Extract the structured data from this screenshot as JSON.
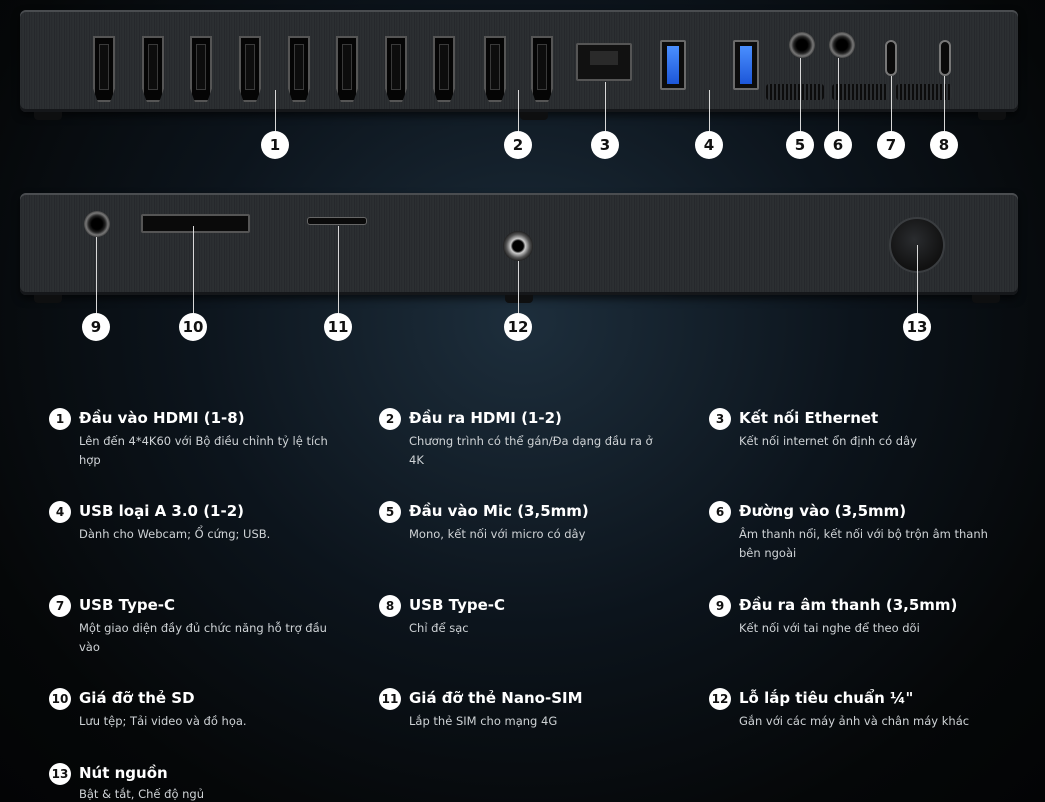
{
  "callouts": [
    "1",
    "2",
    "3",
    "4",
    "5",
    "6",
    "7",
    "8",
    "9",
    "10",
    "11",
    "12",
    "13"
  ],
  "features": [
    {
      "num": "1",
      "title": "Đầu vào HDMI (1-8)",
      "desc": "Lên đến 4*4K60 với Bộ điều chỉnh tỷ lệ tích hợp"
    },
    {
      "num": "2",
      "title": "Đầu ra HDMI (1-2)",
      "desc": "Chương trình có thể gán/Đa dạng đầu ra ở 4K"
    },
    {
      "num": "3",
      "title": "Kết nối Ethernet",
      "desc": "Kết nối internet ổn định có dây"
    },
    {
      "num": "4",
      "title": "USB loại A 3.0 (1-2)",
      "desc": "Dành cho Webcam; Ổ cứng; USB."
    },
    {
      "num": "5",
      "title": "Đầu vào Mic (3,5mm)",
      "desc": "Mono, kết nối với micro có dây"
    },
    {
      "num": "6",
      "title": "Đường vào (3,5mm)",
      "desc": "Âm thanh nổi, kết nối với bộ trộn âm thanh bên ngoài"
    },
    {
      "num": "7",
      "title": "USB Type-C",
      "desc": "Một giao diện đầy đủ chức năng hỗ trợ đầu vào"
    },
    {
      "num": "8",
      "title": "USB Type-C",
      "desc": "Chỉ để sạc"
    },
    {
      "num": "9",
      "title": "Đầu ra âm thanh (3,5mm)",
      "desc": "Kết nối với tai nghe để theo dõi"
    },
    {
      "num": "10",
      "title": "Giá đỡ thẻ SD",
      "desc": "Lưu tệp; Tải video và đồ họa."
    },
    {
      "num": "11",
      "title": "Giá đỡ thẻ Nano-SIM",
      "desc": "Lắp thẻ SIM cho mạng 4G"
    },
    {
      "num": "12",
      "title": "Lỗ lắp tiêu chuẩn ¼\"",
      "desc": "Gắn với các máy ảnh và chân máy khác"
    },
    {
      "num": "13",
      "title": "Nút nguồn",
      "desc": "Bật & tắt, Chế độ ngủ"
    }
  ]
}
